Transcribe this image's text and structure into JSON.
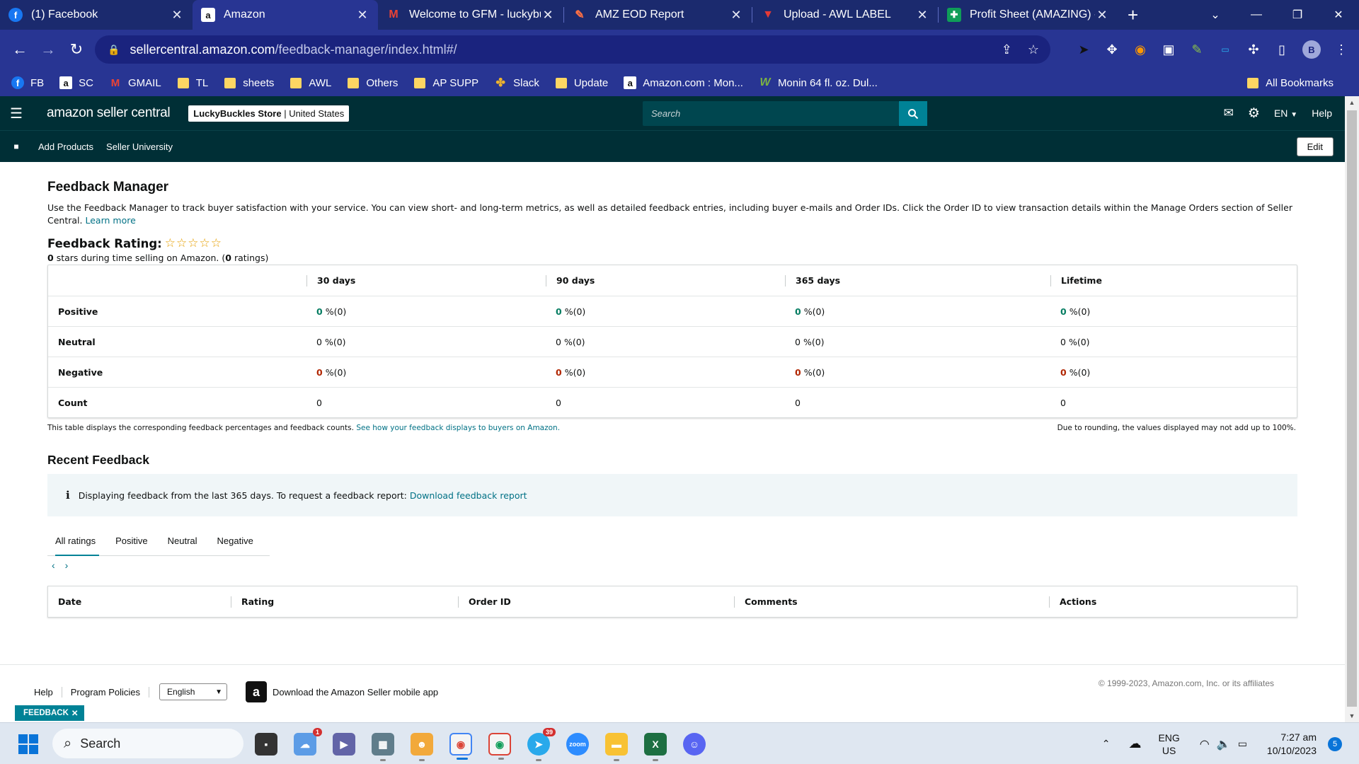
{
  "browser": {
    "tabs": [
      {
        "label": "(1) Facebook",
        "icon": "facebook-icon",
        "active": false
      },
      {
        "label": "Amazon",
        "icon": "amazon-icon",
        "active": true
      },
      {
        "label": "Welcome to GFM - luckybu",
        "icon": "gmail-icon",
        "active": false
      },
      {
        "label": "AMZ EOD Report",
        "icon": "report-icon",
        "active": false
      },
      {
        "label": "Upload - AWL LABEL",
        "icon": "awl-icon",
        "active": false
      },
      {
        "label": "Profit Sheet (AMAZING) - (",
        "icon": "sheets-icon",
        "active": false
      }
    ],
    "url_host": "sellercentral.amazon.com",
    "url_path": "/feedback-manager/index.html#/",
    "profile_initial": "B",
    "bookmarks": [
      {
        "label": "FB",
        "icon": "facebook-icon"
      },
      {
        "label": "SC",
        "icon": "amazon-icon"
      },
      {
        "label": "GMAIL",
        "icon": "gmail-icon"
      },
      {
        "label": "TL",
        "icon": "folder-icon"
      },
      {
        "label": "sheets",
        "icon": "folder-icon"
      },
      {
        "label": "AWL",
        "icon": "folder-icon"
      },
      {
        "label": "Others",
        "icon": "folder-icon"
      },
      {
        "label": "AP SUPP",
        "icon": "folder-icon"
      },
      {
        "label": "Slack",
        "icon": "slack-icon"
      },
      {
        "label": "Update",
        "icon": "folder-icon"
      },
      {
        "label": "Amazon.com : Mon...",
        "icon": "amazon-icon"
      },
      {
        "label": "Monin 64 fl. oz. Dul...",
        "icon": "walmart-icon"
      }
    ],
    "all_bookmarks": "All Bookmarks"
  },
  "header": {
    "logo": "amazon seller central",
    "store_name": "LuckyBuckles Store",
    "store_region": "United States",
    "search_placeholder": "Search",
    "language": "EN",
    "help": "Help",
    "nav": [
      "Add Products",
      "Seller University"
    ],
    "edit": "Edit"
  },
  "feedback_manager": {
    "title": "Feedback Manager",
    "intro": "Use the Feedback Manager to track buyer satisfaction with your service. You can view short- and long-term metrics, as well as detailed feedback entries, including buyer e-mails and Order IDs. Click the Order ID to view transaction details within the Manage Orders section of Seller Central.",
    "learn_more": "Learn more",
    "rating_label": "Feedback Rating:",
    "stars": "☆☆☆☆☆",
    "stars_count": "0",
    "stars_text": "stars during time selling on Amazon. (",
    "ratings_count": "0",
    "ratings_text": "ratings)",
    "table": {
      "columns": [
        "30 days",
        "90 days",
        "365 days",
        "Lifetime"
      ],
      "rows": [
        {
          "label": "Positive",
          "kind": "pos",
          "values": [
            {
              "num": "0",
              "rest": "%(0)"
            },
            {
              "num": "0",
              "rest": "%(0)"
            },
            {
              "num": "0",
              "rest": "%(0)"
            },
            {
              "num": "0",
              "rest": "%(0)"
            }
          ]
        },
        {
          "label": "Neutral",
          "kind": "neu",
          "values": [
            {
              "num": "0",
              "rest": "%(0)"
            },
            {
              "num": "0",
              "rest": "%(0)"
            },
            {
              "num": "0",
              "rest": "%(0)"
            },
            {
              "num": "0",
              "rest": "%(0)"
            }
          ]
        },
        {
          "label": "Negative",
          "kind": "neg",
          "values": [
            {
              "num": "0",
              "rest": "%(0)"
            },
            {
              "num": "0",
              "rest": "%(0)"
            },
            {
              "num": "0",
              "rest": "%(0)"
            },
            {
              "num": "0",
              "rest": "%(0)"
            }
          ]
        },
        {
          "label": "Count",
          "kind": "cnt",
          "values": [
            {
              "num": "0",
              "rest": ""
            },
            {
              "num": "0",
              "rest": ""
            },
            {
              "num": "0",
              "rest": ""
            },
            {
              "num": "0",
              "rest": ""
            }
          ]
        }
      ]
    },
    "table_note": "This table displays the corresponding feedback percentages and feedback counts.",
    "table_note_link": "See how your feedback displays to buyers on Amazon.",
    "rounding_note": "Due to rounding, the values displayed may not add up to 100%."
  },
  "recent_feedback": {
    "title": "Recent Feedback",
    "info_text": "Displaying feedback from the last 365 days. To request a feedback report:",
    "info_link": "Download feedback report",
    "tabs": [
      "All ratings",
      "Positive",
      "Neutral",
      "Negative"
    ],
    "columns": [
      "Date",
      "Rating",
      "Order ID",
      "Comments",
      "Actions"
    ]
  },
  "footer": {
    "links": [
      "Help",
      "Program Policies"
    ],
    "language": "English",
    "app_download": "Download the Amazon Seller mobile app",
    "copyright": "© 1999-2023, Amazon.com, Inc. or its affiliates",
    "feedback_badge": "FEEDBACK"
  },
  "taskbar": {
    "search": "Search",
    "lang_top": "ENG",
    "lang_bottom": "US",
    "time": "7:27 am",
    "date": "10/10/2023",
    "notifications": "5",
    "badge_weather": "1",
    "badge_telegram": "39"
  }
}
